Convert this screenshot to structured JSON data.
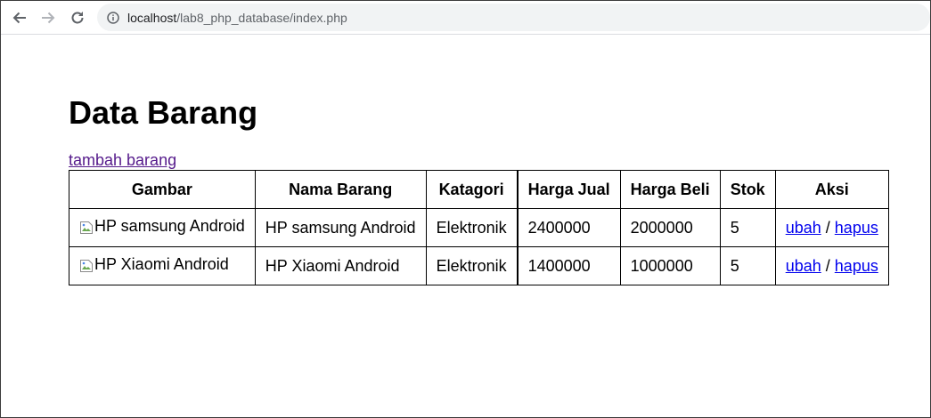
{
  "browser": {
    "url_host": "localhost",
    "url_path": "/lab8_php_database/index.php"
  },
  "page": {
    "title": "Data Barang",
    "add_link": "tambah barang"
  },
  "table": {
    "headers": [
      "Gambar",
      "Nama Barang",
      "Katagori",
      "Harga Jual",
      "Harga Beli",
      "Stok",
      "Aksi"
    ],
    "rows": [
      {
        "gambar_alt": "HP samsung Android",
        "nama": "HP samsung Android",
        "kategori": "Elektronik",
        "harga_jual": "2400000",
        "harga_beli": "2000000",
        "stok": "5",
        "ubah": "ubah",
        "sep": "/",
        "hapus": "hapus"
      },
      {
        "gambar_alt": "HP Xiaomi Android",
        "nama": "HP Xiaomi Android",
        "kategori": "Elektronik",
        "harga_jual": "1400000",
        "harga_beli": "1000000",
        "stok": "5",
        "ubah": "ubah",
        "sep": "/",
        "hapus": "hapus"
      }
    ]
  },
  "icons": {
    "back": "arrow-left-icon",
    "forward": "arrow-right-icon",
    "reload": "reload-icon",
    "info": "info-icon",
    "broken_image": "broken-image-icon"
  },
  "colors": {
    "visited_link": "#551a8b",
    "link": "#0000ee",
    "omnibox": "#f1f3f4"
  }
}
